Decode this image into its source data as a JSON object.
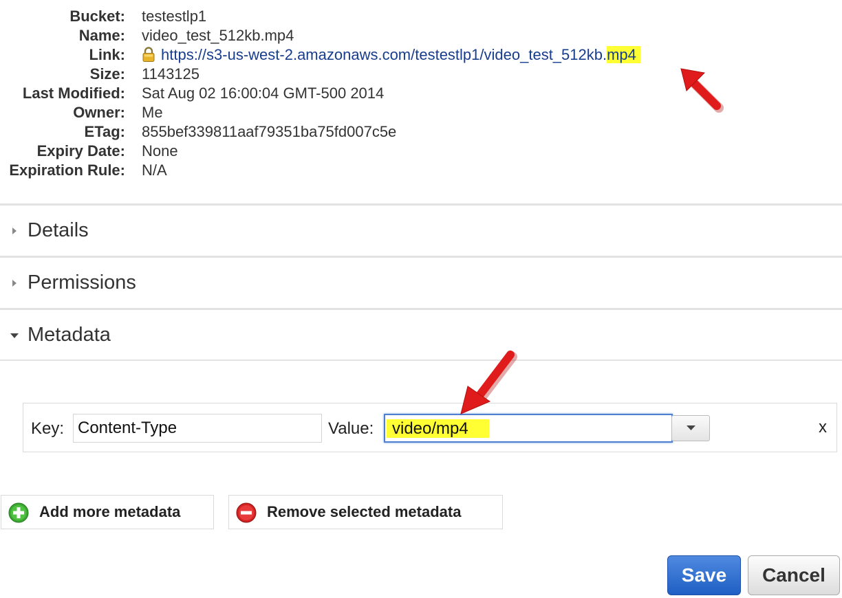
{
  "properties": {
    "bucket_label": "Bucket:",
    "bucket_value": "testestlp1",
    "name_label": "Name:",
    "name_value": "video_test_512kb.mp4",
    "link_label": "Link:",
    "link_url_main": "https://s3-us-west-2.amazonaws.com/testestlp1/video_test_512kb.",
    "link_url_ext": "mp4",
    "size_label": "Size:",
    "size_value": "1143125",
    "modified_label": "Last Modified:",
    "modified_value": "Sat Aug 02 16:00:04 GMT-500 2014",
    "owner_label": "Owner:",
    "owner_value": "Me",
    "etag_label": "ETag:",
    "etag_value": "855bef339811aaf79351ba75fd007c5e",
    "expiry_label": "Expiry Date:",
    "expiry_value": "None",
    "expiration_rule_label": "Expiration Rule:",
    "expiration_rule_value": "N/A"
  },
  "sections": {
    "details": "Details",
    "permissions": "Permissions",
    "metadata": "Metadata"
  },
  "metadata_row": {
    "key_label": "Key:",
    "key_value": "Content-Type",
    "value_label": "Value:",
    "value_value": "video/mp4",
    "remove_label": "x"
  },
  "actions": {
    "add_label": "Add more metadata",
    "remove_label": "Remove selected metadata",
    "save_label": "Save",
    "cancel_label": "Cancel"
  },
  "icons": {
    "lock": "lock-icon",
    "collapsed": "triangle-right-icon",
    "expanded": "triangle-down-icon",
    "add": "plus-circle-icon",
    "remove": "minus-circle-icon",
    "dropdown": "chevron-down-icon",
    "annotation": "arrow-icon"
  },
  "colors": {
    "link": "#173d8c",
    "highlight": "#ffff33",
    "save": "#2a6ad4",
    "arrow": "#e01b1b"
  }
}
